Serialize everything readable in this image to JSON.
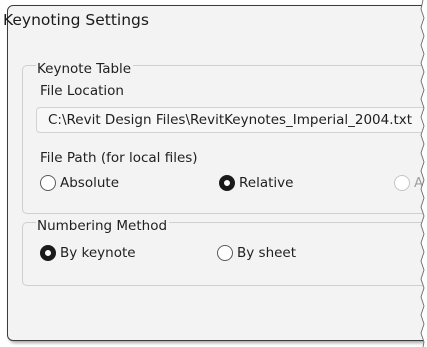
{
  "dialog": {
    "title": "Keynoting Settings"
  },
  "keynote_table": {
    "legend": "Keynote Table",
    "file_location_label": "File Location",
    "file_location_value": "C:\\Revit Design Files\\RevitKeynotes_Imperial_2004.txt",
    "file_path_label": "File Path (for local files)",
    "options": [
      {
        "label": "Absolute",
        "selected": false,
        "enabled": true
      },
      {
        "label": "Relative",
        "selected": true,
        "enabled": true
      },
      {
        "label": "A",
        "selected": false,
        "enabled": false
      }
    ]
  },
  "numbering": {
    "legend": "Numbering Method",
    "options": [
      {
        "label": "By keynote",
        "selected": true
      },
      {
        "label": "By sheet",
        "selected": false
      }
    ]
  },
  "colors": {
    "dialog_background": "#f3f3f3",
    "selected_radio": "#1a1a1a",
    "disabled_text": "#a0a0a0"
  }
}
